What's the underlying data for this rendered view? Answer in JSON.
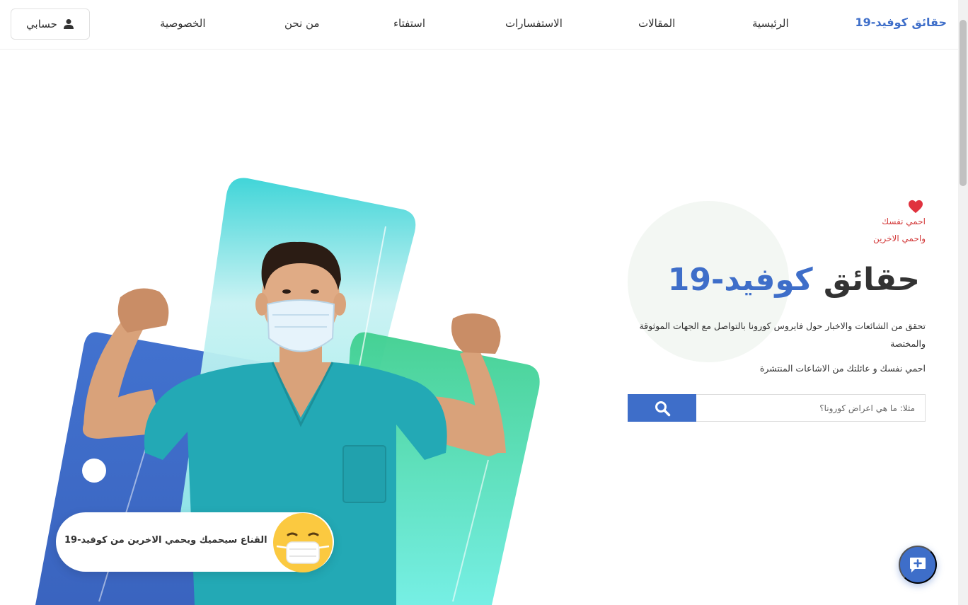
{
  "navbar": {
    "brand": "حقائق كوفيد-19",
    "links": [
      "الرئيسية",
      "المقالات",
      "الاستفسارات",
      "استفتاء",
      "من نحن",
      "الخصوصية"
    ],
    "account_label": "حسابي"
  },
  "hero": {
    "tagline_1": "احمي نفسك",
    "tagline_2": "واحمي الاخرين",
    "title_dark": "حقائق",
    "title_accent": "كوفيد-19",
    "description": "تحقق من الشائعات والاخبار حول فايروس كورونا بالتواصل مع الجهات الموثوقة والمختصة",
    "subtext": "احمي نفسك و عائلتك من الاشاعات المنتشرة"
  },
  "search": {
    "placeholder": "مثلا: ما هي اعراض كورونا؟"
  },
  "illustration": {
    "speech_text": "القناع سيحميك ويحمي الاخرين من كوفيد-19"
  },
  "icons": {
    "account": "user-icon",
    "heart": "heart-icon",
    "search": "search-icon",
    "chat": "chat-plus-icon",
    "emoji": "mask-face-emoji-icon"
  },
  "colors": {
    "brand": "#3e6ec9",
    "heart": "#e0323e",
    "tagline": "#d33a3a",
    "teal": "#37d3d6",
    "green": "#3fcf8f"
  }
}
